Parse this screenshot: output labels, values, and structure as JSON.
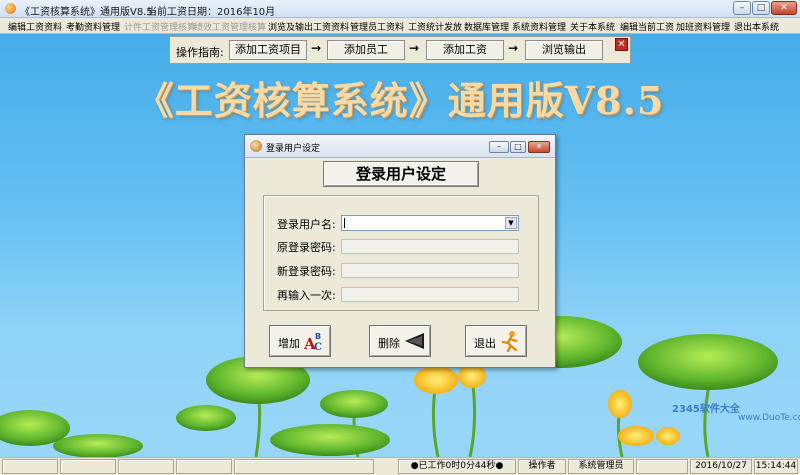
{
  "window": {
    "title": "《工资核算系统》通用版V8.5",
    "period": "当前工资日期：2016年10月",
    "min_glyph": "–",
    "max_glyph": "□",
    "close_glyph": "✕"
  },
  "menu": [
    {
      "label": "编辑工资资料",
      "enabled": true
    },
    {
      "label": "考勤资料管理",
      "enabled": true
    },
    {
      "label": "计件工资管理核算",
      "enabled": false
    },
    {
      "label": "绩效工资管理核算",
      "enabled": false
    },
    {
      "label": "浏览及输出工资资料",
      "enabled": true
    },
    {
      "label": "管理员工资料",
      "enabled": true
    },
    {
      "label": "工资统计发放",
      "enabled": true
    },
    {
      "label": "数据库管理",
      "enabled": true
    },
    {
      "label": "系统资料管理",
      "enabled": true
    },
    {
      "label": "关于本系统",
      "enabled": true
    },
    {
      "label": "编辑当前工资",
      "enabled": true
    },
    {
      "label": "加班资料管理",
      "enabled": true
    },
    {
      "label": "退出本系统",
      "enabled": true
    }
  ],
  "guide": {
    "label": "操作指南:",
    "steps": [
      "添加工资项目",
      "添加员工",
      "添加工资",
      "浏览输出"
    ],
    "arrow": "→",
    "close_glyph": "✕"
  },
  "banner": "《工资核算系统》通用版V8.5",
  "dialog": {
    "title": "登录用户设定",
    "heading": "登录用户设定",
    "fields": {
      "username_label": "登录用户名:",
      "username_value": "",
      "old_password_label": "原登录密码:",
      "new_password_label": "新登录密码:",
      "confirm_label": "再输入一次:"
    },
    "buttons": {
      "add": "增加",
      "delete": "删除",
      "exit": "退出"
    },
    "dropdown_glyph": "▼"
  },
  "watermark": {
    "main": "www.DuoTe.com",
    "brand": "2345软件大全",
    "brand_url": "www.DuoTe.com"
  },
  "status": {
    "worked": "●已工作0时0分44秒●",
    "operator_label": "操作者",
    "operator": "系统管理员",
    "date": "2016/10/27",
    "time": "15:14:44"
  },
  "colors": {
    "sky": "#4fb3ec",
    "banner_text": "#f6d9a5",
    "leaf": "#6cc23a",
    "flower": "#ffc21a"
  }
}
